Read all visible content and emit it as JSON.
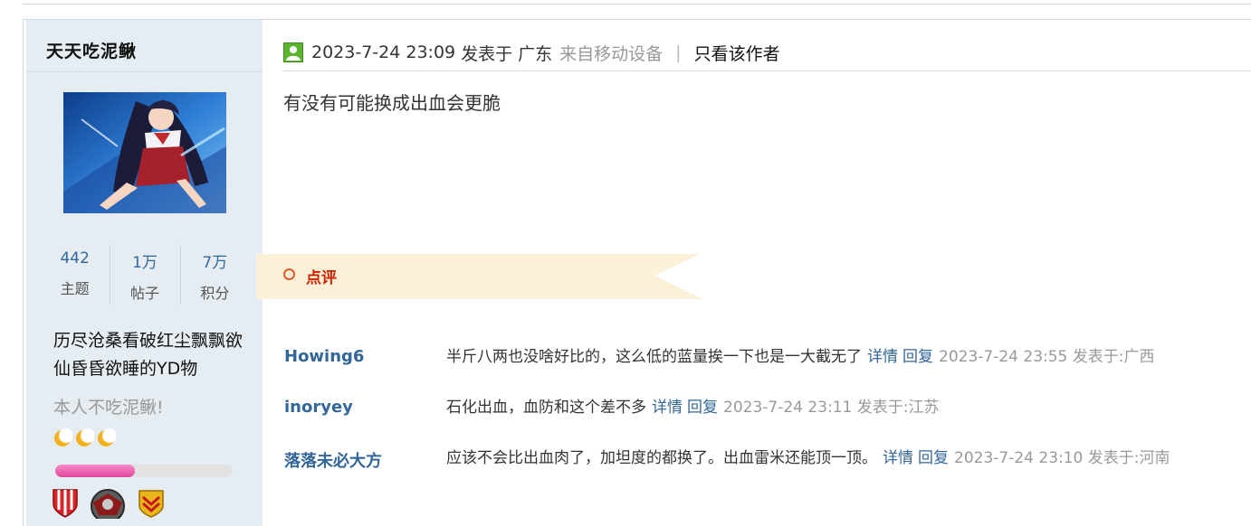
{
  "author": {
    "name": "天天吃泥鳅",
    "stats": [
      {
        "value": "442",
        "label": "主题"
      },
      {
        "value": "1万",
        "label": "帖子"
      },
      {
        "value": "7万",
        "label": "积分"
      }
    ],
    "signature": "历尽沧桑看破红尘飘飘欲仙昏昏欲睡的YD物",
    "title": "本人不吃泥鳅!",
    "level_progress": 0.45
  },
  "post": {
    "date": "2023-7-24 23:09",
    "publish_label": "发表于",
    "region": "广东",
    "source": "来自移动设备",
    "separator": "|",
    "only_author": "只看该作者",
    "body": "有没有可能换成出血会更脆"
  },
  "comments_section": {
    "label": "点评",
    "items": [
      {
        "user": "Howing6",
        "text": "半斤八两也没啥好比的，这么低的蓝量挨一下也是一大截无了",
        "detail": "详情",
        "reply": "回复",
        "time": "2023-7-24 23:55 发表于:广西"
      },
      {
        "user": "inoryey",
        "text": "石化出血，血防和这个差不多",
        "detail": "详情",
        "reply": "回复",
        "time": "2023-7-24 23:11 发表于:江苏"
      },
      {
        "user": "落落未必大方",
        "text": "应该不会比出血肉了，加坦度的都换了。出血雷米还能顶一顶。",
        "detail": "详情",
        "reply": "回复",
        "time": "2023-7-24 23:10 发表于:河南"
      }
    ]
  },
  "colors": {
    "sidebar_bg": "#e5edf2",
    "link": "#336699",
    "banner": "#fdf0d9",
    "comment_label": "#cc2200",
    "level_fill": "#e0459b"
  }
}
